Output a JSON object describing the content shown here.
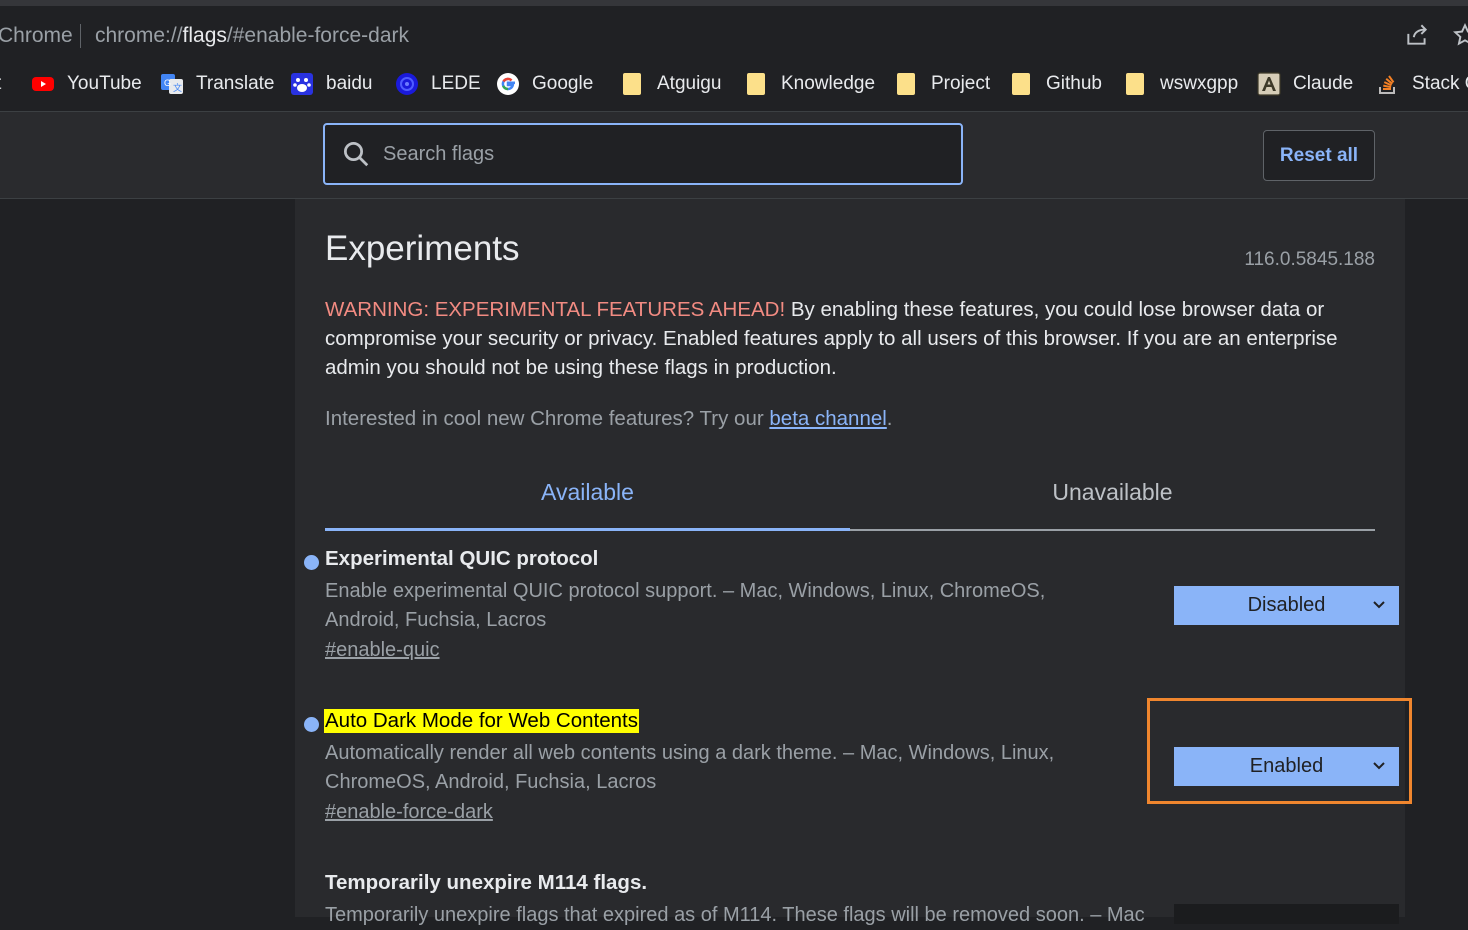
{
  "omnibox": {
    "site_label": "Chrome",
    "url_prefix": "chrome://",
    "url_host": "flags",
    "url_suffix": "/#enable-force-dark"
  },
  "bookmarks": [
    {
      "label": "YouTube",
      "icon": "youtube-icon"
    },
    {
      "label": "Translate",
      "icon": "translate-icon"
    },
    {
      "label": "baidu",
      "icon": "baidu-icon"
    },
    {
      "label": "LEDE",
      "icon": "lede-icon"
    },
    {
      "label": "Google",
      "icon": "google-icon"
    },
    {
      "label": "Atguigu",
      "icon": "folder-icon"
    },
    {
      "label": "Knowledge",
      "icon": "folder-icon"
    },
    {
      "label": "Project",
      "icon": "folder-icon"
    },
    {
      "label": "Github",
      "icon": "folder-icon"
    },
    {
      "label": "wswxgpp",
      "icon": "folder-icon"
    },
    {
      "label": "Claude",
      "icon": "claude-icon"
    },
    {
      "label": "Stack O",
      "icon": "stackoverflow-icon"
    }
  ],
  "header": {
    "search_placeholder": "Search flags",
    "reset_label": "Reset all"
  },
  "page": {
    "title": "Experiments",
    "version": "116.0.5845.188",
    "warning_prefix": "WARNING: EXPERIMENTAL FEATURES AHEAD!",
    "warning_body": " By enabling these features, you could lose browser data or compromise your security or privacy. Enabled features apply to all users of this browser. If you are an enterprise admin you should not be using these flags in production.",
    "interested_text": "Interested in cool new Chrome features? Try our ",
    "beta_link": "beta channel",
    "interested_end": ".",
    "tabs": [
      {
        "label": "Available",
        "active": true
      },
      {
        "label": "Unavailable",
        "active": false
      }
    ]
  },
  "experiments": [
    {
      "name": "Experimental QUIC protocol",
      "description": "Enable experimental QUIC protocol support. – Mac, Windows, Linux, ChromeOS, Android, Fuchsia, Lacros",
      "permalink": "#enable-quic",
      "value": "Disabled"
    },
    {
      "name": "Auto Dark Mode for Web Contents",
      "description": "Automatically render all web contents using a dark theme. – Mac, Windows, Linux, ChromeOS, Android, Fuchsia, Lacros",
      "permalink": "#enable-force-dark",
      "value": "Enabled"
    },
    {
      "name": "Temporarily unexpire M114 flags.",
      "description": "Temporarily unexpire flags that expired as of M114. These flags will be removed soon. – Mac"
    }
  ],
  "colors": {
    "accent": "#8ab4f8",
    "warning": "#f28b82",
    "highlight": "#ffff00",
    "callout_border": "#f0862e"
  }
}
